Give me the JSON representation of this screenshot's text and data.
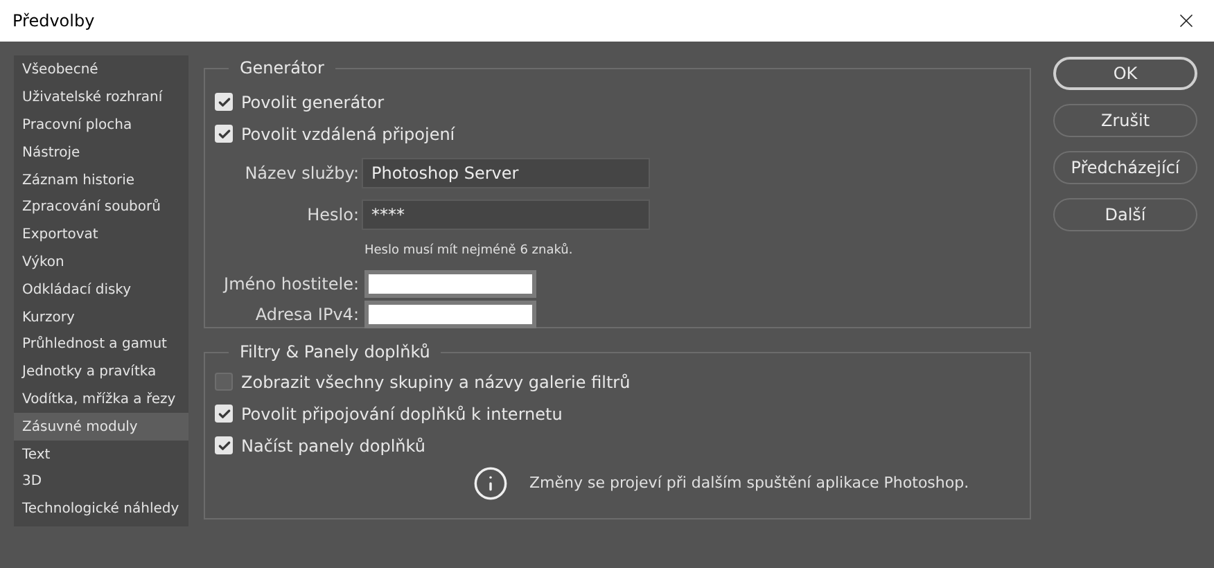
{
  "window": {
    "title": "Předvolby"
  },
  "sidebar": {
    "items": [
      {
        "label": "Všeobecné",
        "selected": false
      },
      {
        "label": "Uživatelské rozhraní",
        "selected": false
      },
      {
        "label": "Pracovní plocha",
        "selected": false
      },
      {
        "label": "Nástroje",
        "selected": false
      },
      {
        "label": "Záznam historie",
        "selected": false
      },
      {
        "label": "Zpracování souborů",
        "selected": false
      },
      {
        "label": "Exportovat",
        "selected": false
      },
      {
        "label": "Výkon",
        "selected": false
      },
      {
        "label": "Odkládací disky",
        "selected": false
      },
      {
        "label": "Kurzory",
        "selected": false
      },
      {
        "label": "Průhlednost a gamut",
        "selected": false
      },
      {
        "label": "Jednotky a pravítka",
        "selected": false
      },
      {
        "label": "Vodítka, mřížka a řezy",
        "selected": false
      },
      {
        "label": "Zásuvné moduly",
        "selected": true
      },
      {
        "label": "Text",
        "selected": false
      },
      {
        "label": "3D",
        "selected": false
      },
      {
        "label": "Technologické náhledy",
        "selected": false
      }
    ]
  },
  "generator": {
    "title": "Generátor",
    "checkboxes": [
      {
        "label": "Povolit generátor",
        "checked": true
      },
      {
        "label": "Povolit vzdálená připojení",
        "checked": true
      }
    ],
    "fields": [
      {
        "kind": "dark",
        "label": "Název služby:",
        "value": "Photoshop Server"
      },
      {
        "kind": "dark",
        "label": "Heslo:",
        "value": "****"
      },
      {
        "kind": "hint",
        "label": "Heslo musí mít nejméně 6 znaků."
      },
      {
        "kind": "blank",
        "label": "Jméno hostitele:"
      },
      {
        "kind": "blank",
        "label": "Adresa IPv4:"
      }
    ]
  },
  "plugins": {
    "title": "Filtry & Panely doplňků",
    "checkboxes": [
      {
        "label": "Zobrazit všechny skupiny a názvy galerie filtrů",
        "checked": false
      },
      {
        "label": "Povolit připojování doplňků k internetu",
        "checked": true
      },
      {
        "label": "Načíst panely doplňků",
        "checked": true
      }
    ],
    "note": "Změny se projeví při dalším spuštění aplikace Photoshop."
  },
  "buttons": [
    {
      "label": "OK",
      "default": true
    },
    {
      "label": "Zrušit",
      "default": false
    },
    {
      "label": "Předcházející",
      "default": false
    },
    {
      "label": "Další",
      "default": false
    }
  ]
}
